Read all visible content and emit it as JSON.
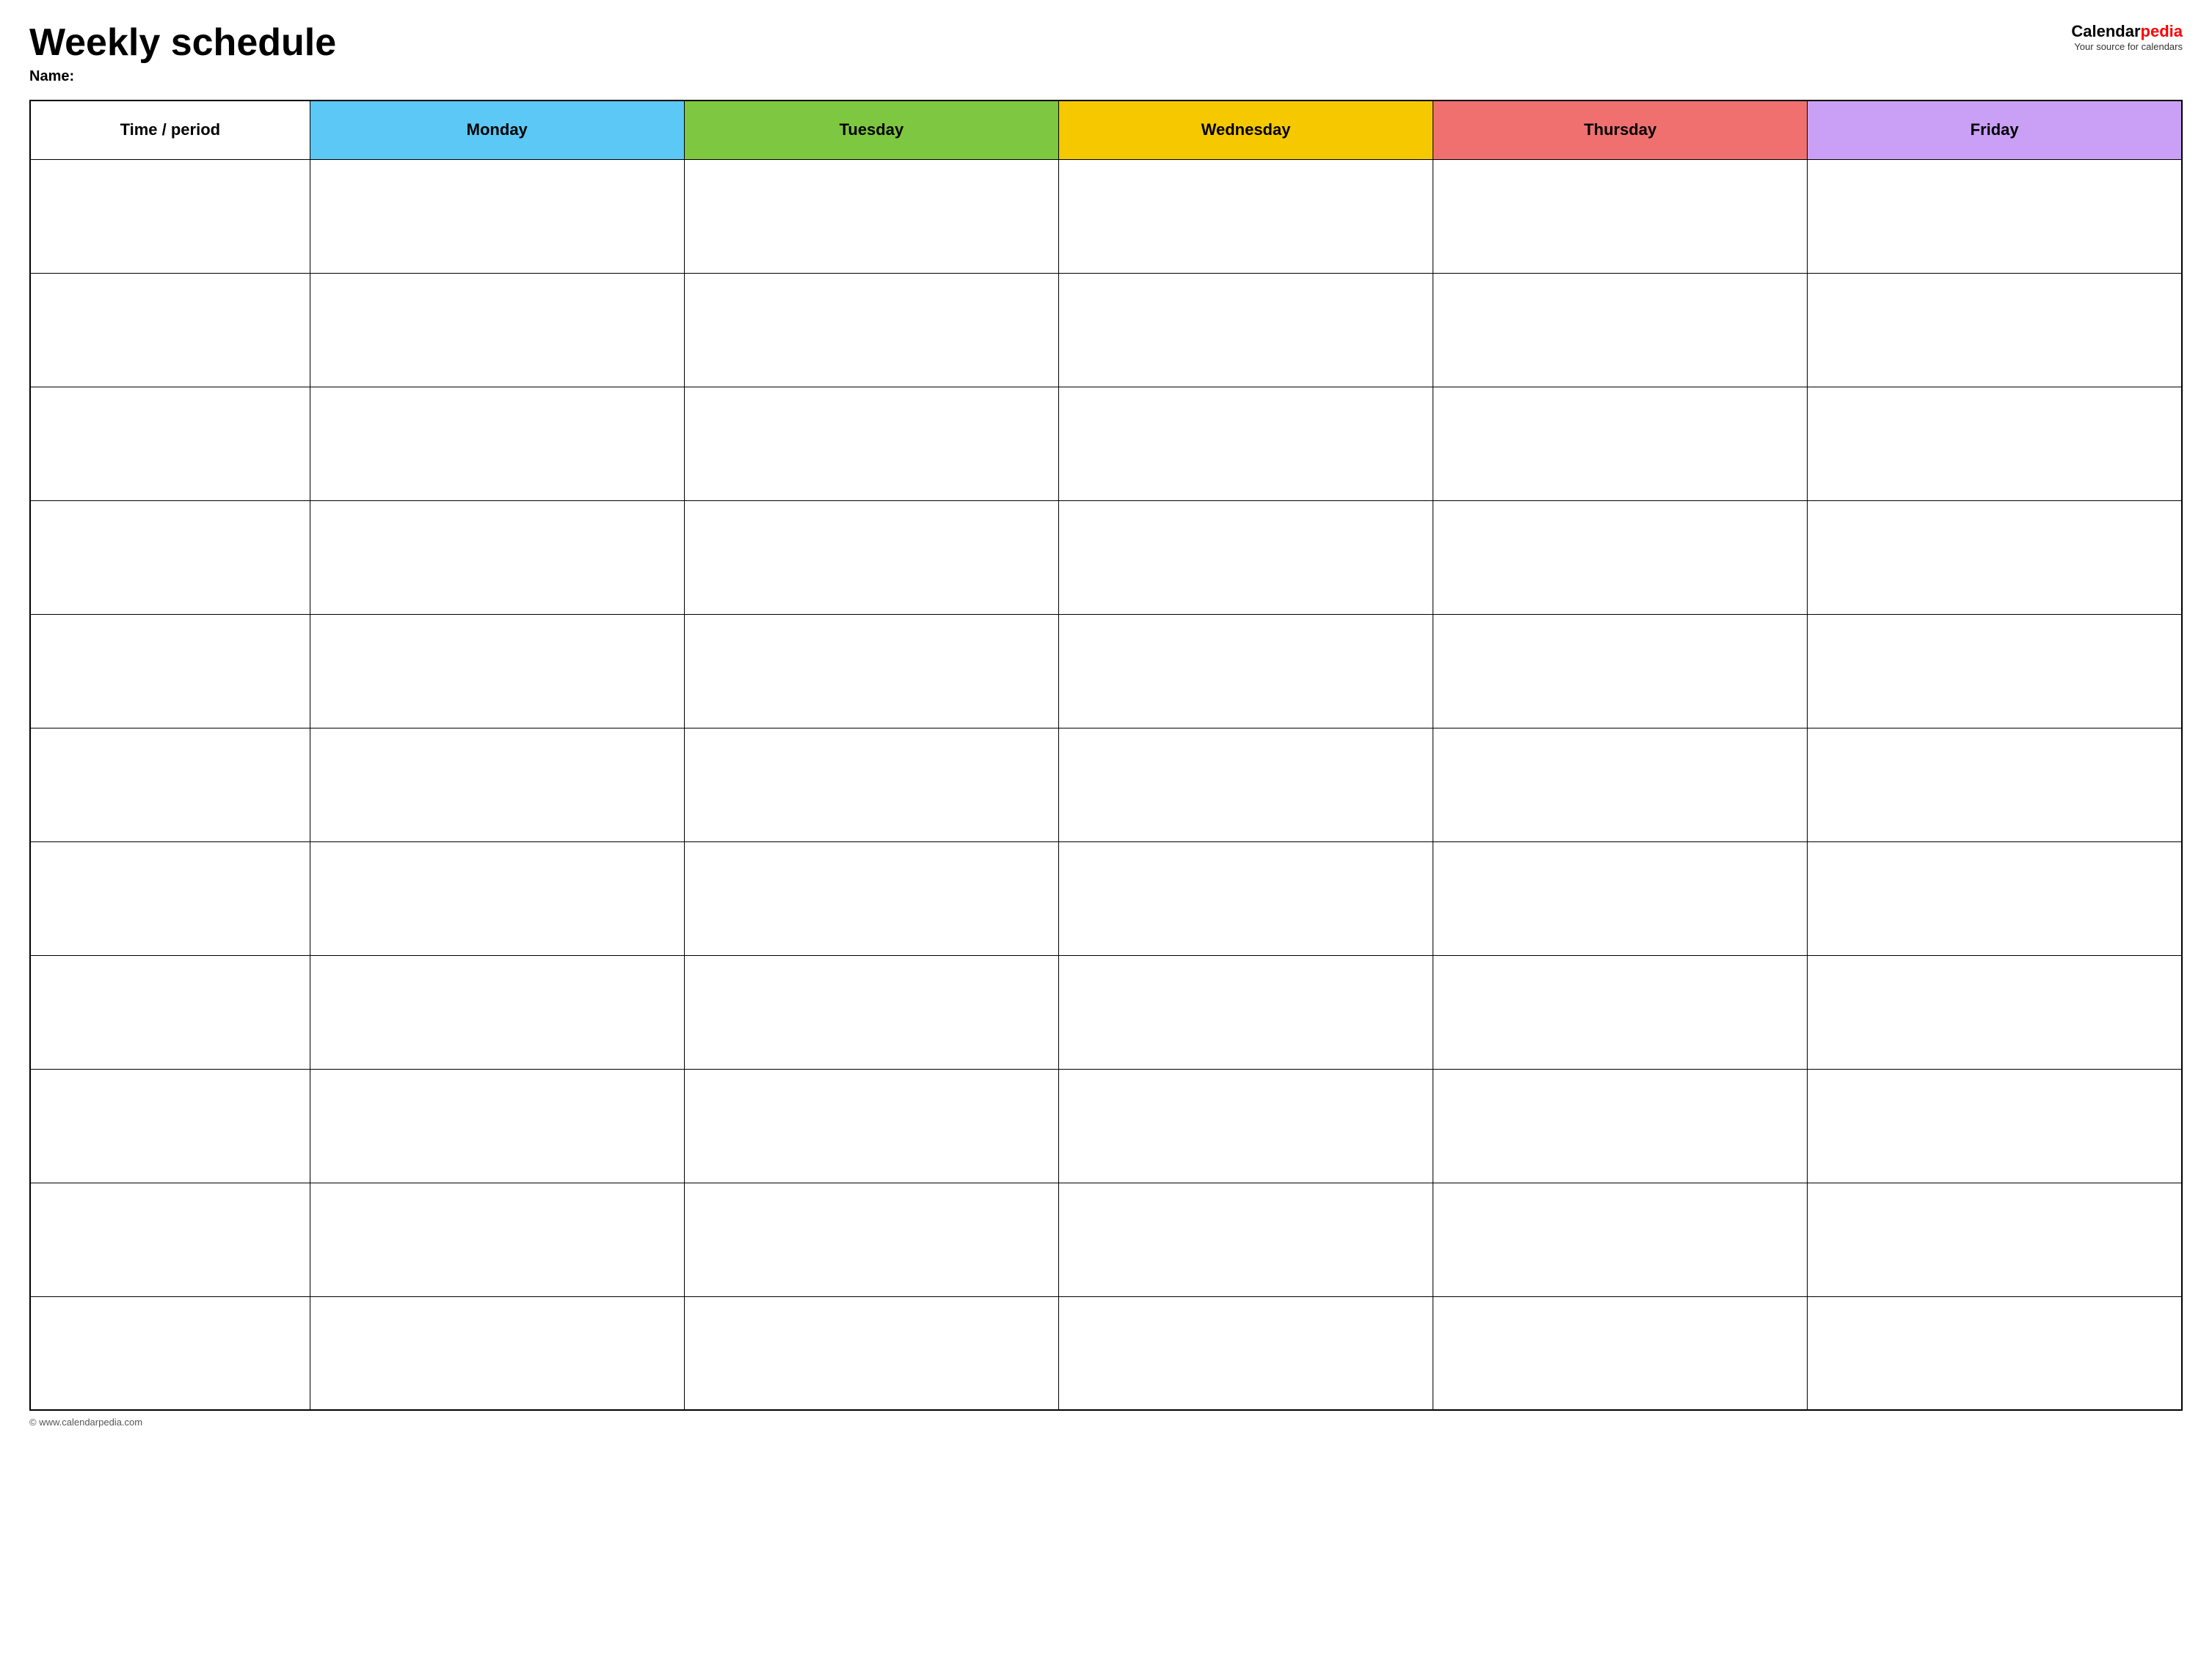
{
  "header": {
    "title": "Weekly schedule",
    "name_label": "Name:",
    "logo_calendar": "Calendar",
    "logo_pedia": "pedia",
    "logo_subtitle": "Your source for calendars"
  },
  "table": {
    "headers": [
      {
        "id": "time",
        "label": "Time / period",
        "color": "white"
      },
      {
        "id": "monday",
        "label": "Monday",
        "color": "#5bc8f5"
      },
      {
        "id": "tuesday",
        "label": "Tuesday",
        "color": "#7ec740"
      },
      {
        "id": "wednesday",
        "label": "Wednesday",
        "color": "#f5c800"
      },
      {
        "id": "thursday",
        "label": "Thursday",
        "color": "#f07070"
      },
      {
        "id": "friday",
        "label": "Friday",
        "color": "#c9a0f5"
      }
    ],
    "row_count": 11
  },
  "footer": {
    "url": "© www.calendarpedia.com"
  }
}
